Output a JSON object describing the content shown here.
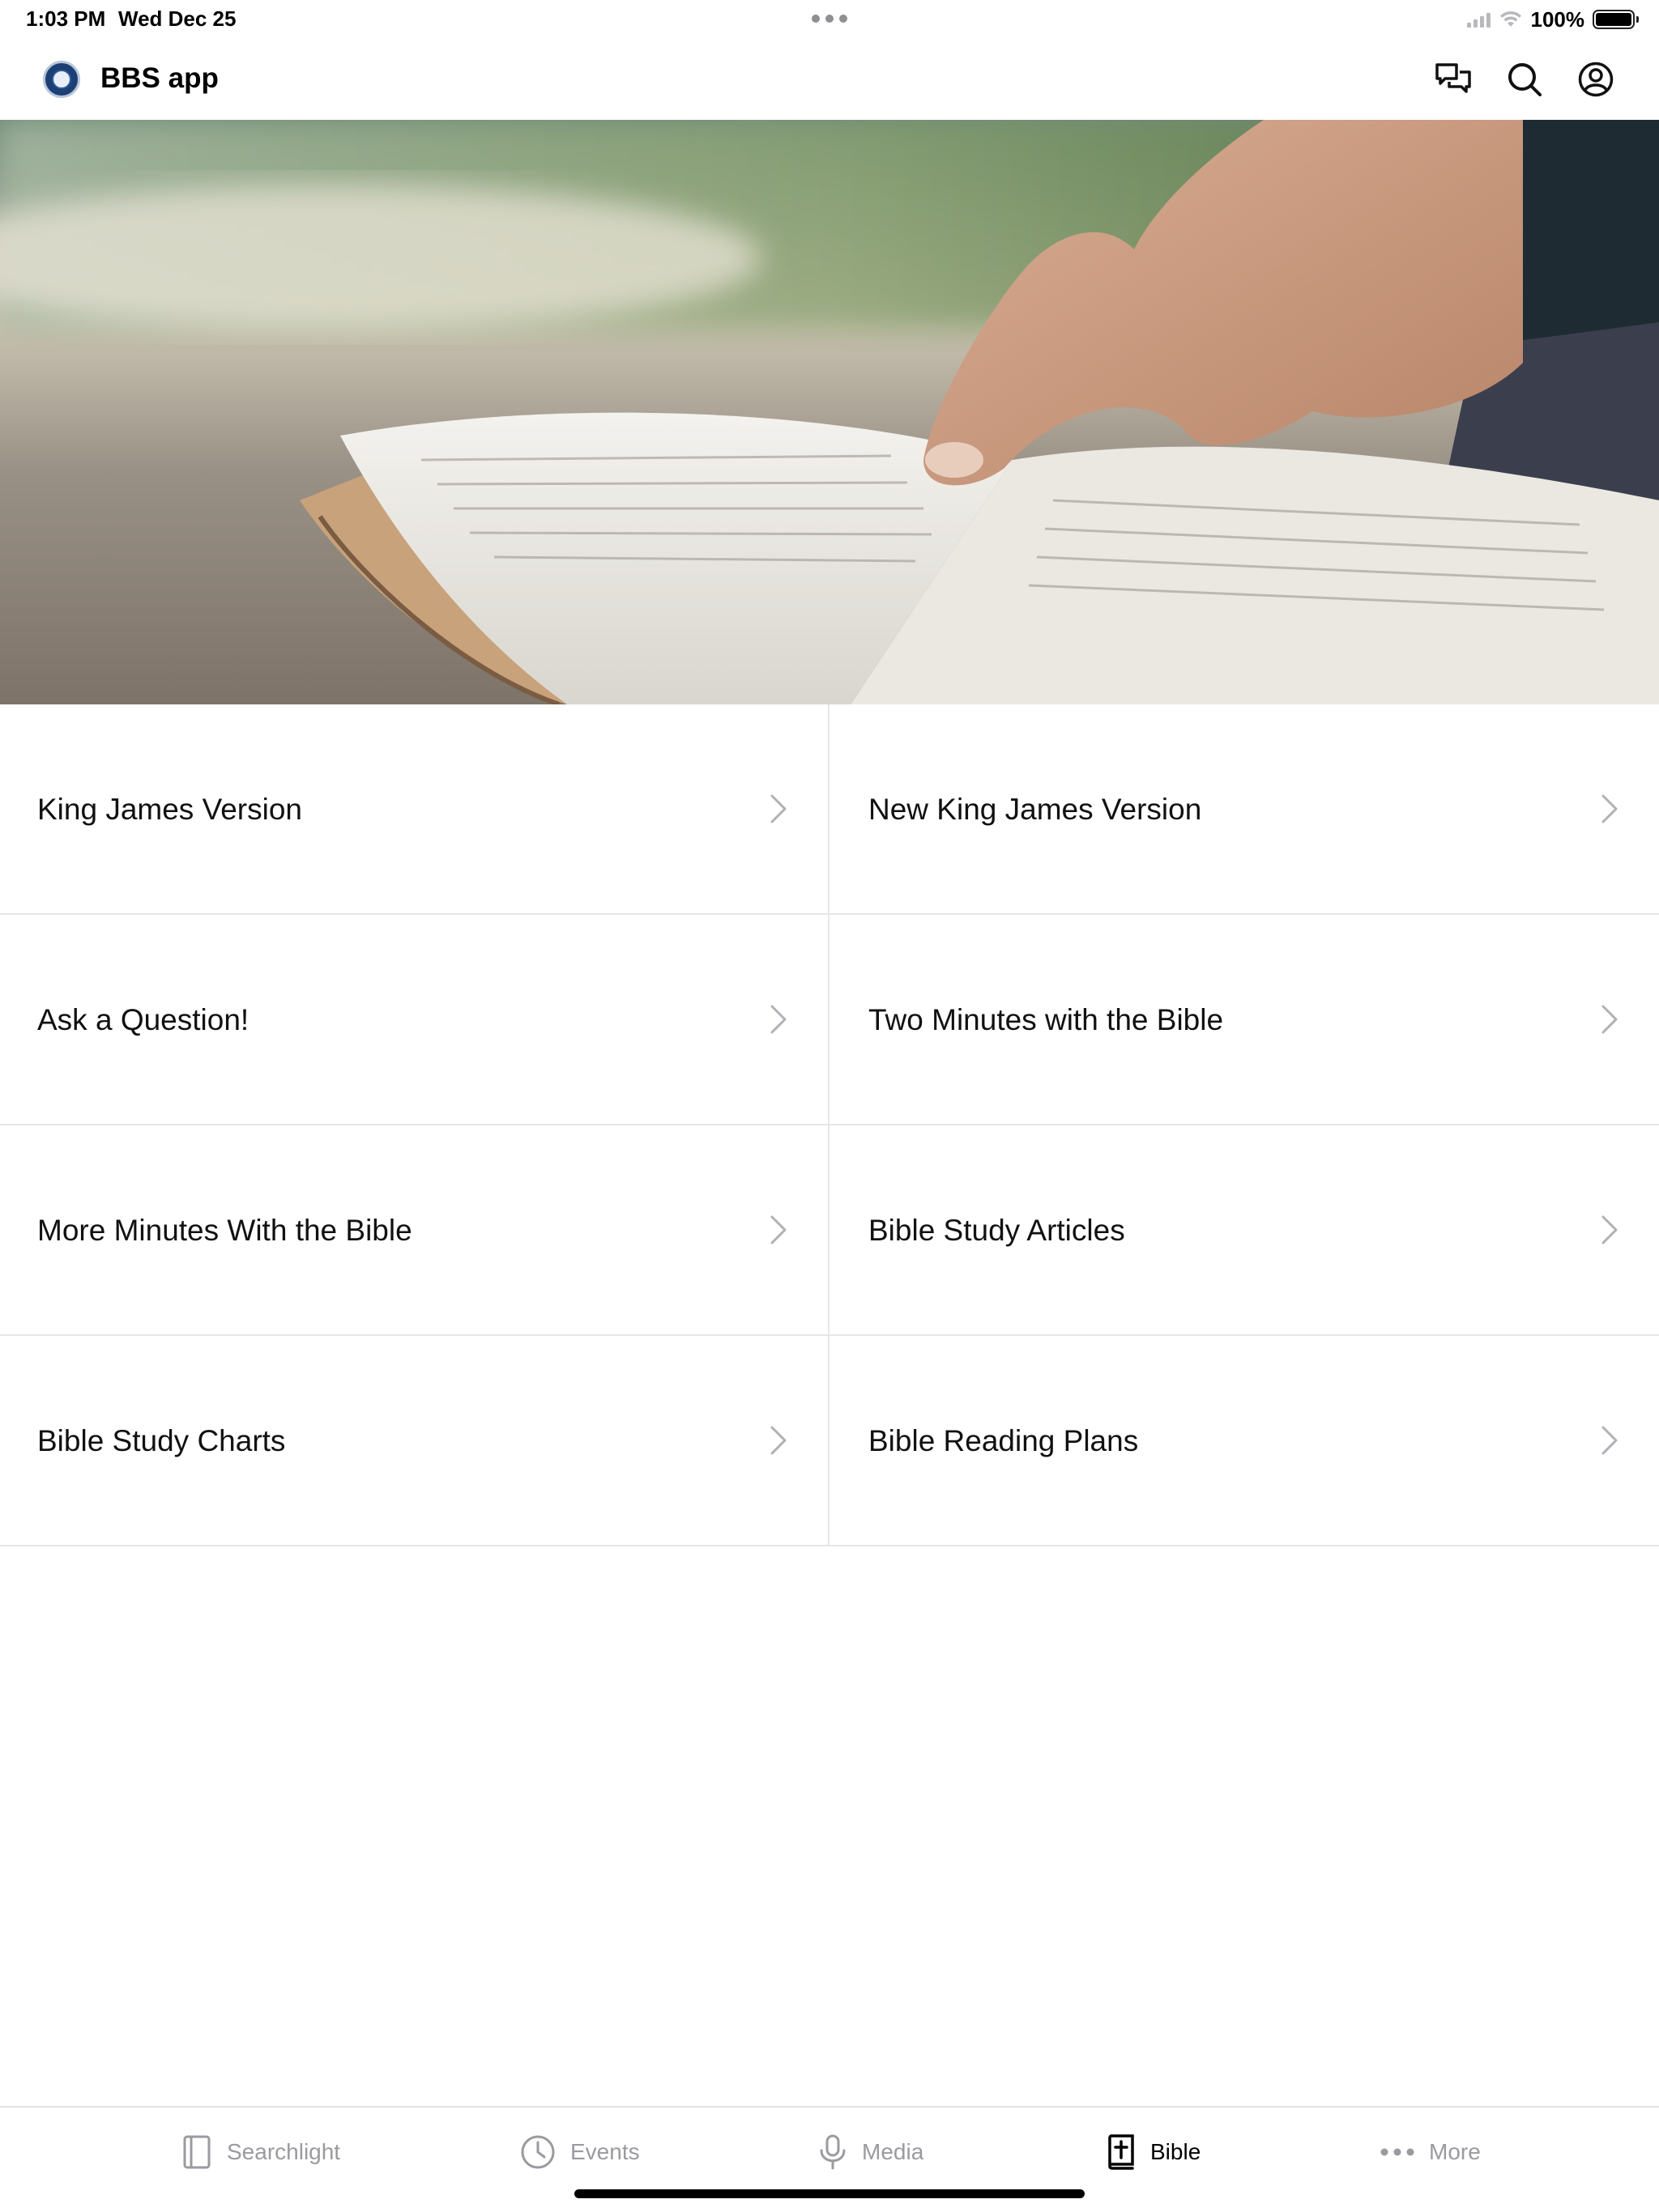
{
  "status_bar": {
    "time": "1:03 PM",
    "date": "Wed Dec 25",
    "battery": "100%",
    "icons": [
      "signal-icon",
      "wifi-icon",
      "battery-icon"
    ]
  },
  "header": {
    "app_title": "BBS app",
    "logo": "bbs-logo",
    "icons": [
      "chat-icon",
      "search-icon",
      "profile-icon"
    ]
  },
  "hero": {
    "image": "open-bible-with-pointing-finger"
  },
  "menu": {
    "items": [
      {
        "label": "King James Version"
      },
      {
        "label": "New King James Version"
      },
      {
        "label": "Ask a Question!"
      },
      {
        "label": "Two Minutes with the Bible"
      },
      {
        "label": "More Minutes With the Bible"
      },
      {
        "label": "Bible Study Articles"
      },
      {
        "label": "Bible Study Charts"
      },
      {
        "label": "Bible Reading Plans"
      }
    ],
    "chevron_icon": "chevron-right-icon"
  },
  "tab_bar": {
    "tabs": [
      {
        "label": "Searchlight",
        "icon": "book-outline-icon",
        "active": false
      },
      {
        "label": "Events",
        "icon": "clock-icon",
        "active": false
      },
      {
        "label": "Media",
        "icon": "microphone-icon",
        "active": false
      },
      {
        "label": "Bible",
        "icon": "bible-cross-icon",
        "active": true
      },
      {
        "label": "More",
        "icon": "ellipsis-icon",
        "active": false
      }
    ]
  },
  "colors": {
    "background": "#ffffff",
    "divider": "#e6e6e8",
    "inactive_tab": "#9a9a9f",
    "active_tab": "#000000",
    "chevron": "#b0b0b5"
  }
}
